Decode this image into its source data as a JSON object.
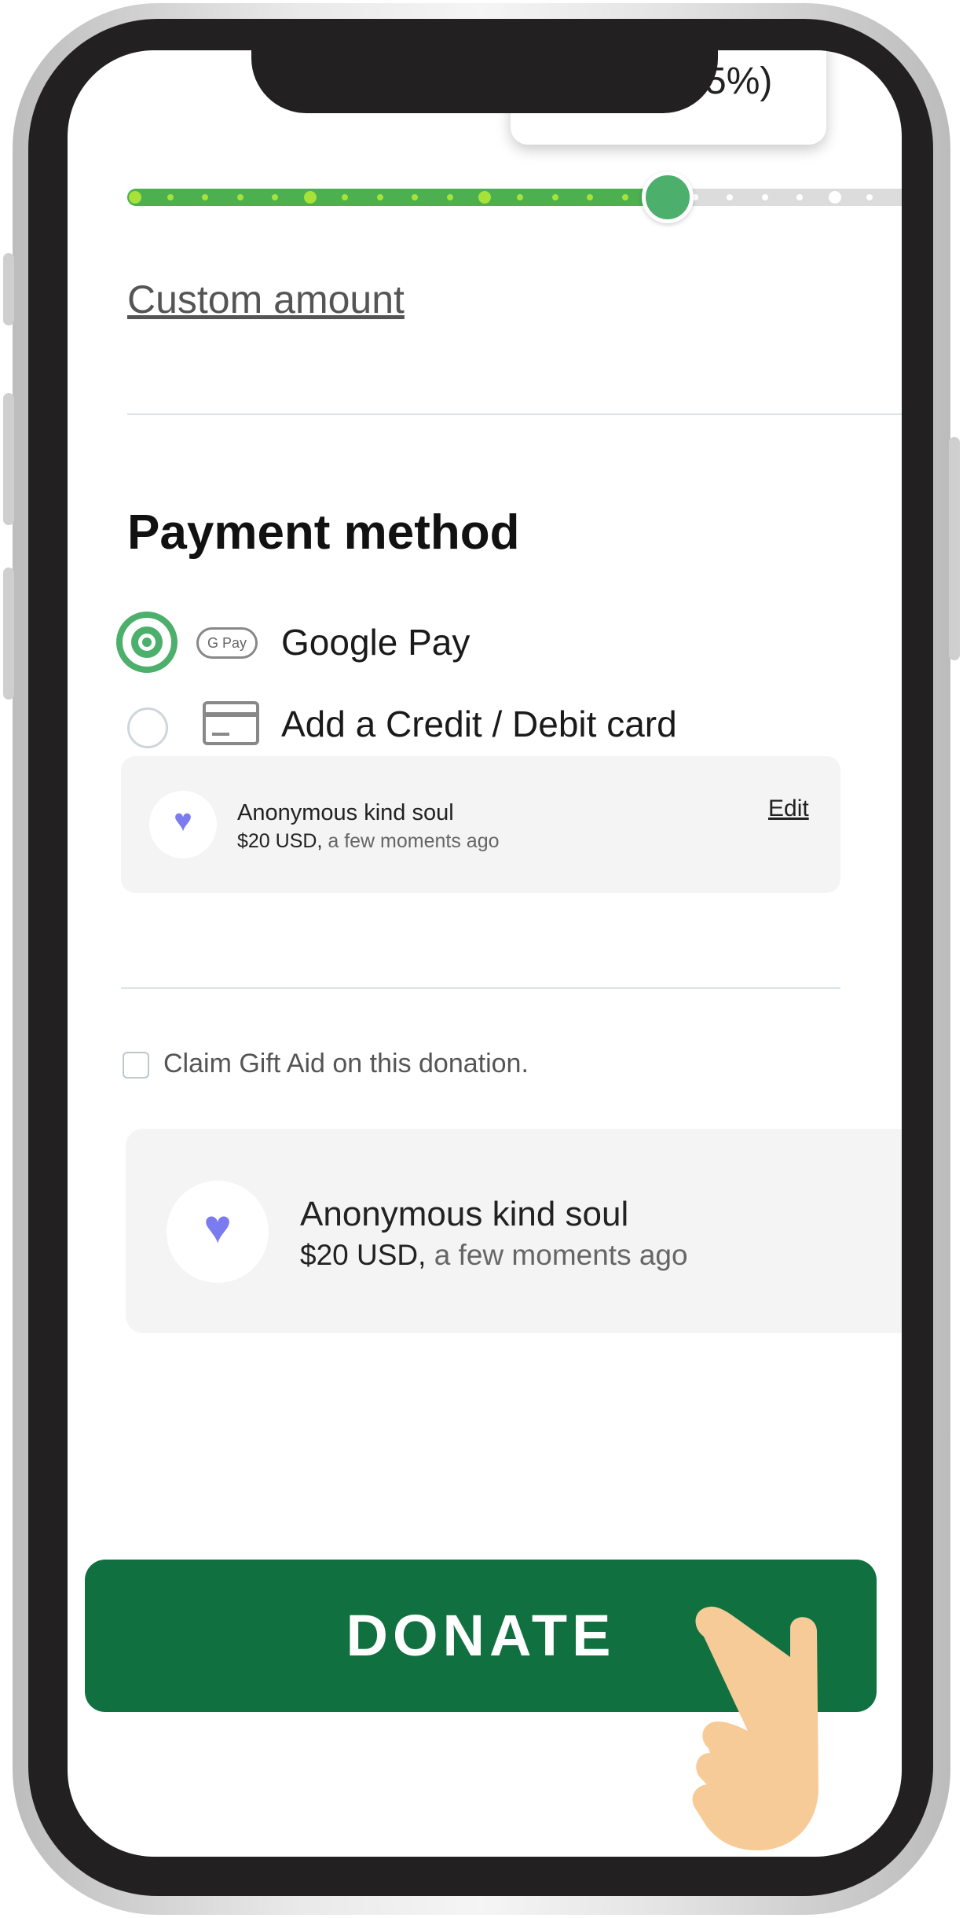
{
  "amount_tooltip": {
    "visible_text": "5%)"
  },
  "slider": {
    "level_percent": 68.8
  },
  "custom_amount_link": "Custom amount",
  "payment": {
    "title": "Payment method",
    "options": [
      {
        "label": "Google Pay",
        "logo_text": "G Pay",
        "selected": true
      },
      {
        "label": "Add a Credit / Debit card",
        "selected": false
      }
    ]
  },
  "donor_preview_small": {
    "name": "Anonymous kind soul",
    "amount": "$20 USD,",
    "time": "a few moments ago",
    "edit_label": "Edit",
    "icon": "heart-icon"
  },
  "gift_aid": {
    "label": "Claim Gift Aid on this donation.",
    "checked": false
  },
  "donor_preview_large": {
    "name": "Anonymous kind soul",
    "amount": "$20 USD,",
    "time": "a few moments ago",
    "icon": "heart-icon"
  },
  "donate_button": "DONATE",
  "colors": {
    "brand_green": "#11703f",
    "accent_green": "#4caf6b",
    "tick_green": "#a6e23a",
    "heart": "#7b7bf0",
    "frame": "#222021"
  }
}
